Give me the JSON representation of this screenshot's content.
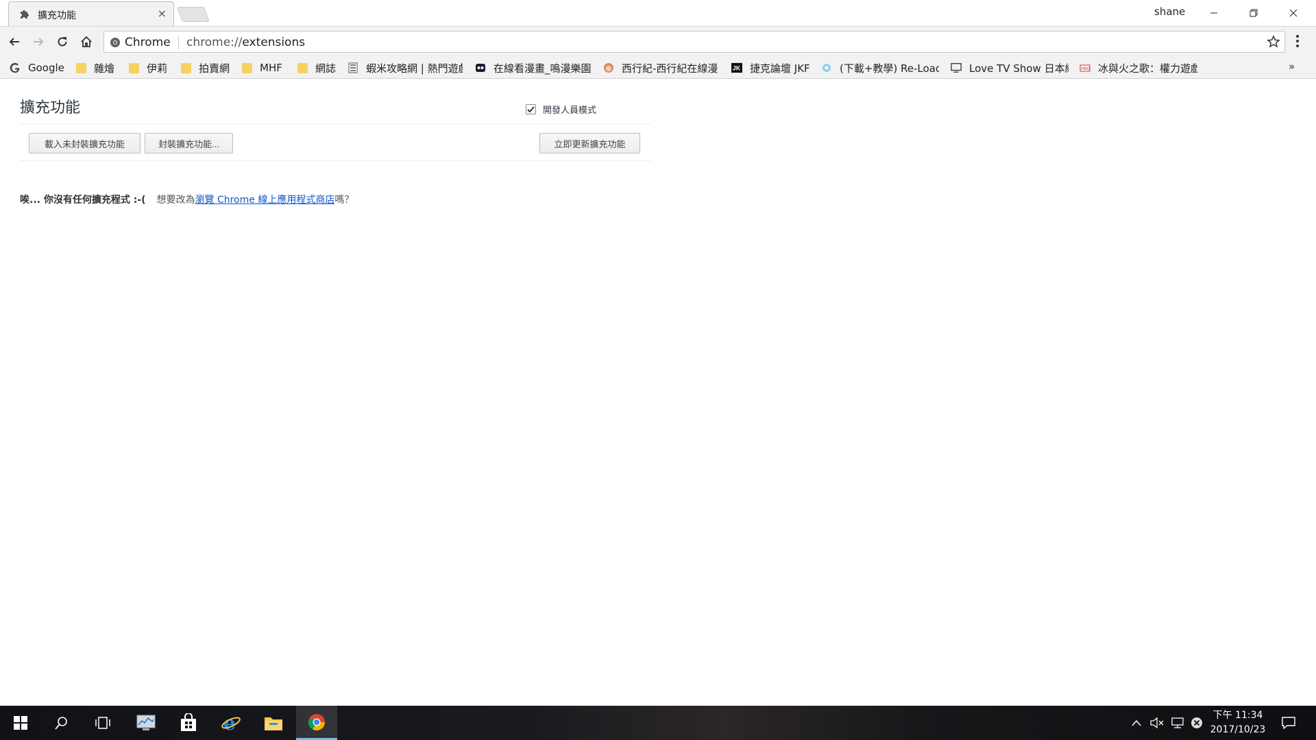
{
  "window": {
    "tab_title": "擴充功能",
    "tab_close": "×",
    "profile_name": "shane"
  },
  "toolbar": {
    "omnibox_chip": "Chrome",
    "url_scheme": "chrome://",
    "url_host": "extensions"
  },
  "bookmarks": {
    "items": [
      {
        "label": "Google",
        "icon": "google-g-icon"
      },
      {
        "label": "雜燴",
        "icon": "folder-icon"
      },
      {
        "label": "伊莉",
        "icon": "folder-icon"
      },
      {
        "label": "拍賣網",
        "icon": "folder-icon"
      },
      {
        "label": "MHF",
        "icon": "folder-icon"
      },
      {
        "label": "網誌",
        "icon": "folder-icon"
      },
      {
        "label": "蝦米攻略網 | 熱門遊戲",
        "icon": "site-icon"
      },
      {
        "label": "在線看漫畫_嗚漫樂園",
        "icon": "site-icon"
      },
      {
        "label": "西行紀-西行紀在線漫",
        "icon": "site-icon"
      },
      {
        "label": "捷克論壇 JKF",
        "icon": "jkf-icon"
      },
      {
        "label": "(下載+教學) Re-Load",
        "icon": "site-icon"
      },
      {
        "label": "Love TV Show 日本綜",
        "icon": "monitor-icon"
      },
      {
        "label": "冰與火之歌：權力遊戲",
        "icon": "site-icon"
      }
    ],
    "more": "»"
  },
  "page": {
    "title": "擴充功能",
    "dev_mode_label": "開發人員模式",
    "dev_mode_checked": true,
    "buttons": {
      "load_unpacked": "載入未封裝擴充功能",
      "pack": "封裝擴充功能...",
      "update": "立即更新擴充功能"
    },
    "empty": {
      "no_extensions": "唉... 你沒有任何擴充程式 :-(",
      "prompt_prefix": "想要改為",
      "store_link": "瀏覽 Chrome 線上應用程式商店",
      "prompt_suffix": "嗎？"
    }
  },
  "taskbar": {
    "clock_period_time": "下午 11:34",
    "clock_date": "2017/10/23"
  },
  "colors": {
    "link": "#1155cc",
    "taskbar_accent": "#76b9ed"
  }
}
